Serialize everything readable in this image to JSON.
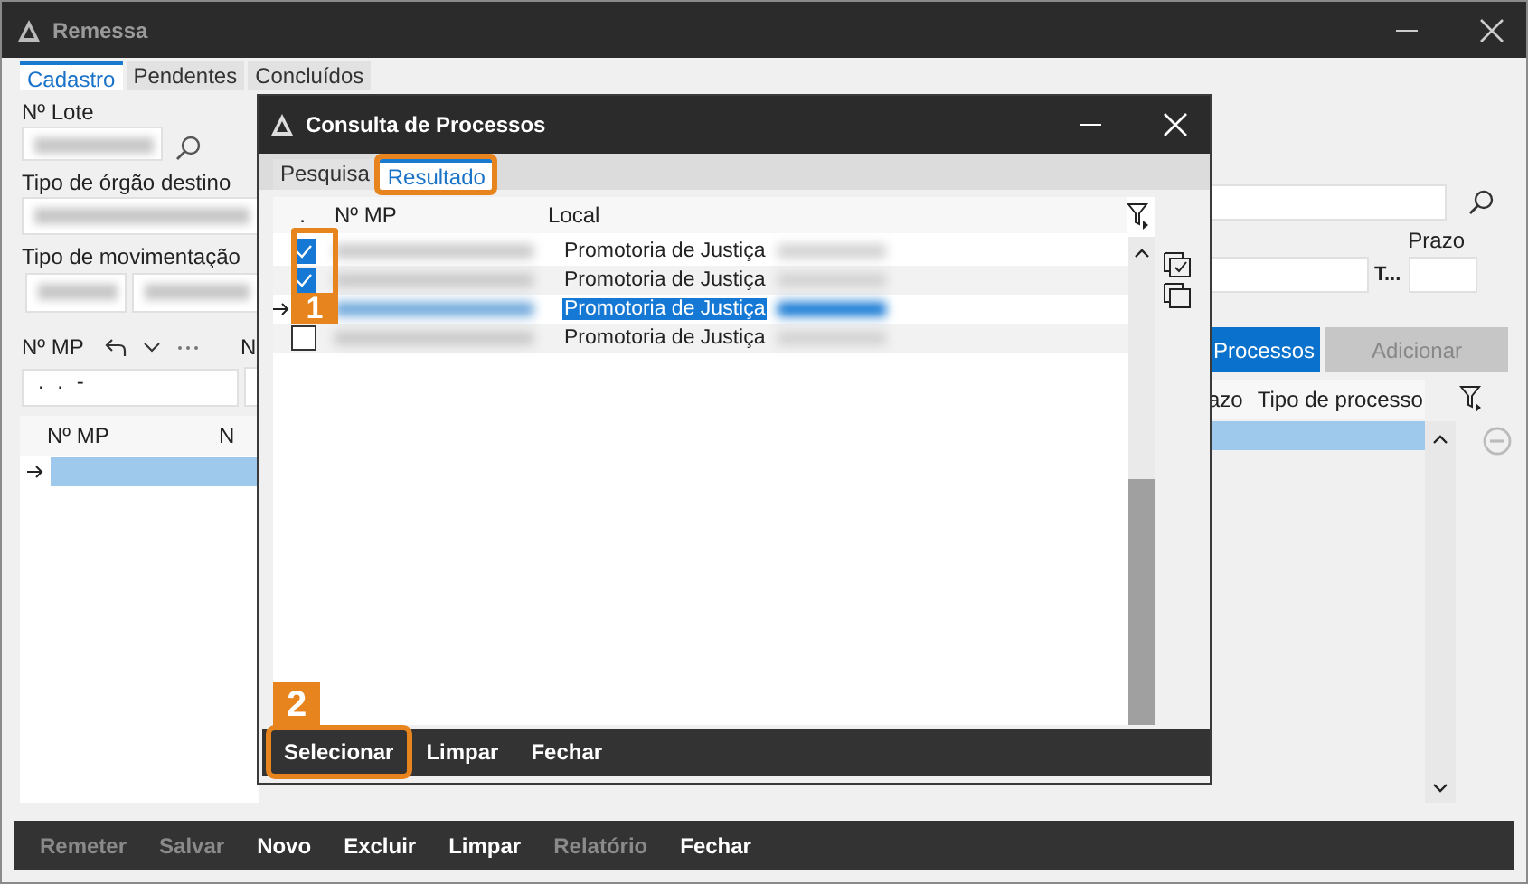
{
  "window": {
    "title": "Remessa"
  },
  "tabs": [
    {
      "label": "Cadastro",
      "selected": true
    },
    {
      "label": "Pendentes",
      "selected": false
    },
    {
      "label": "Concluídos",
      "selected": false
    }
  ],
  "form_left": {
    "lote_label": "Nº Lote",
    "orgao_label": "Tipo de órgão destino",
    "movimentacao_label": "Tipo de movimentação",
    "mp_label": "Nº MP",
    "column_2_label": "N",
    "mp_mask": ". . -"
  },
  "form_right": {
    "prazo_label": "Prazo",
    "t_label": "T...",
    "process_button": "Processos",
    "add_button": {
      "label": "Adicionar",
      "disabled": true
    }
  },
  "main_grid": {
    "columns_left": [
      "Nº MP",
      "N"
    ],
    "columns_right": [
      "azo",
      "Tipo de processo"
    ]
  },
  "bottom_bar": [
    {
      "label": "Remeter",
      "disabled": true
    },
    {
      "label": "Salvar",
      "disabled": true
    },
    {
      "label": "Novo",
      "disabled": false
    },
    {
      "label": "Excluir",
      "disabled": false
    },
    {
      "label": "Limpar",
      "disabled": false
    },
    {
      "label": "Relatório",
      "disabled": true
    },
    {
      "label": "Fechar",
      "disabled": false
    }
  ],
  "dialog": {
    "title": "Consulta de Processos",
    "tabs": [
      {
        "label": "Pesquisa",
        "selected": false,
        "highlighted": false
      },
      {
        "label": "Resultado",
        "selected": true,
        "highlighted": true
      }
    ],
    "columns": [
      ".",
      "Nº MP",
      "Local"
    ],
    "rows": [
      {
        "checked": true,
        "local": "Promotoria de Justiça",
        "selected": false,
        "current": false
      },
      {
        "checked": true,
        "local": "Promotoria de Justiça",
        "selected": false,
        "current": false
      },
      {
        "local": "Promotoria de Justiça",
        "selected": true,
        "current": true
      },
      {
        "checked": false,
        "local": "Promotoria de Justiça",
        "selected": false,
        "current": false
      }
    ],
    "buttons": [
      {
        "label": "Selecionar",
        "highlighted": true
      },
      {
        "label": "Limpar",
        "highlighted": false
      },
      {
        "label": "Fechar",
        "highlighted": false
      }
    ]
  },
  "annotations": [
    {
      "label": "1"
    },
    {
      "label": "2"
    }
  ]
}
